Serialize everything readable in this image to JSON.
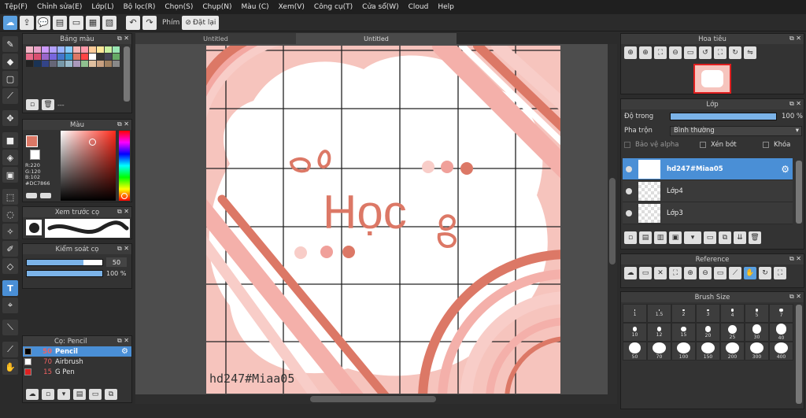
{
  "menu": [
    "Tệp(F)",
    "Chỉnh sửa(E)",
    "Lớp(L)",
    "Bộ lọc(R)",
    "Chọn(S)",
    "Chụp(N)",
    "Màu (C)",
    "Xem(V)",
    "Công cụ(T)",
    "Cửa sổ(W)",
    "Cloud",
    "Help"
  ],
  "toolbar": {
    "keys_label": "Phím",
    "reset_label": "Đặt lại"
  },
  "palette_panel": {
    "title": "Bảng màu",
    "footer_text": "---",
    "colors": [
      "#f3b8c8",
      "#e8a0c8",
      "#cc99ff",
      "#b3a0ff",
      "#99b3ff",
      "#88ccff",
      "#f5b5b5",
      "#ff99aa",
      "#ffcc99",
      "#ffe699",
      "#c8f0a0",
      "#99e6b3",
      "#e86b8a",
      "#d94f70",
      "#9966cc",
      "#7766dd",
      "#4477cc",
      "#3399cc",
      "#dc7866",
      "#ff4444",
      "#ffffff",
      "#333333",
      "#444455",
      "#66aa66",
      "#222222",
      "#1a3355",
      "#334488",
      "#666677",
      "#7799aa",
      "#99bbcc",
      "#aa99bb",
      "#8fbf8f",
      "#e0c0a0",
      "#c8a080",
      "#a08060",
      "#888888"
    ]
  },
  "color_panel": {
    "title": "Màu",
    "main_color": "#dc7866",
    "r_label": "R:220",
    "g_label": "G:120",
    "b_label": "B:102",
    "hex_label": "#DC7866"
  },
  "brush_preview": {
    "title": "Xem trước cọ"
  },
  "brush_control": {
    "title": "Kiểm soát cọ",
    "size_value": "50",
    "size_fraction": 0.75,
    "opacity_value": "100 %",
    "opacity_fraction": 1.0
  },
  "brush_list": {
    "title": "Cọ: Pencil",
    "items": [
      {
        "size": "50",
        "name": "Pencil",
        "color": "#000000"
      },
      {
        "size": "70",
        "name": "Airbrush",
        "color": "#ffffff"
      },
      {
        "size": "15",
        "name": "G Pen",
        "color": "#dc2222"
      }
    ]
  },
  "tabs": [
    "Untitled",
    "Untitled"
  ],
  "artwork": {
    "title": "Học",
    "signature": "hd247#Miaa05",
    "accent": "#dc7866",
    "light": "#f5b5b5"
  },
  "navigator": {
    "title": "Hoa tiêu"
  },
  "layers_panel": {
    "title": "Lớp",
    "opacity_label": "Độ trong",
    "opacity_value": "100 %",
    "blend_label": "Pha trộn",
    "blend_value": "Bình thường",
    "protect_alpha": "Bảo vệ alpha",
    "clip": "Xén bớt",
    "lock": "Khóa",
    "layers": [
      "hd247#Miaa05",
      "Lớp4",
      "Lớp3"
    ]
  },
  "reference": {
    "title": "Reference"
  },
  "brush_size": {
    "title": "Brush Size",
    "sizes": [
      "1",
      "1.5",
      "2",
      "3",
      "4",
      "5",
      "7",
      "10",
      "12",
      "15",
      "20",
      "25",
      "30",
      "40",
      "50",
      "70",
      "100",
      "150",
      "200",
      "300",
      "400"
    ]
  }
}
